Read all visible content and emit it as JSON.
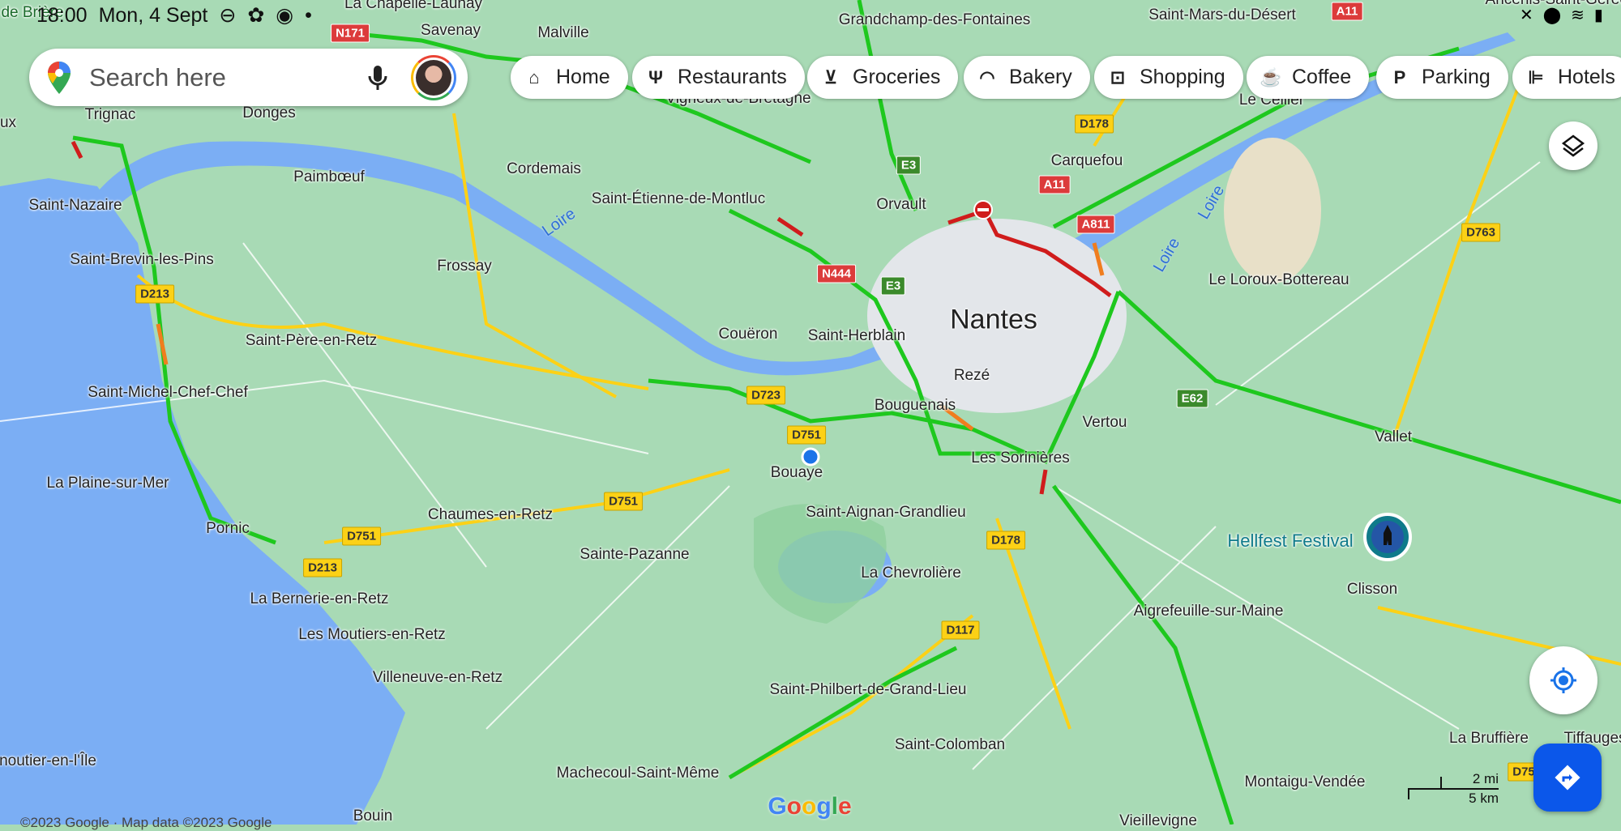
{
  "status_bar": {
    "time": "18:00",
    "date": "Mon, 4 Sept"
  },
  "search": {
    "placeholder": "Search here",
    "mic_icon": "microphone-icon",
    "avatar": "account-avatar"
  },
  "chips": [
    {
      "label": "Home",
      "icon": "home-icon"
    },
    {
      "label": "Restaurants",
      "icon": "fork-knife-icon"
    },
    {
      "label": "Groceries",
      "icon": "cart-icon"
    },
    {
      "label": "Bakery",
      "icon": "bread-icon"
    },
    {
      "label": "Shopping",
      "icon": "shopping-bag-icon"
    },
    {
      "label": "Coffee",
      "icon": "coffee-cup-icon"
    },
    {
      "label": "Parking",
      "icon": "parking-icon"
    },
    {
      "label": "Hotels",
      "icon": "bed-icon"
    }
  ],
  "map": {
    "colors": {
      "land": "#a8dab5",
      "water": "#7baef4",
      "traffic_free": "#1ec81e",
      "traffic_slow": "#f07d1e",
      "traffic_jam": "#d01c1c",
      "main_road": "#fcd116"
    },
    "city": "Nantes",
    "poi": "Hellfest Festival",
    "rivers": [
      "Loire",
      "Loire"
    ],
    "places": [
      "La Chapelle-Launay",
      "Savenay",
      "Malville",
      "Grandchamp-des-Fontaines",
      "Saint-Mars-du-Désert",
      "Ancenis-Saint-Géréon",
      "Trignac",
      "Donges",
      "Vigneux-de-Bretagne",
      "Le Cellier",
      "Saint-Nazaire",
      "Paimbœuf",
      "Cordemais",
      "Saint-Étienne-de-Montluc",
      "Orvault",
      "Carquefou",
      "Saint-Brevin-les-Pins",
      "Frossay",
      "Le Loroux-Bottereau",
      "Saint-Père-en-Retz",
      "Couëron",
      "Saint-Herblain",
      "Rezé",
      "Saint-Michel-Chef-Chef",
      "Bouguenais",
      "Vertou",
      "Vallet",
      "Les Sorinières",
      "Bouaye",
      "La Plaine-sur-Mer",
      "Saint-Aignan-Grandlieu",
      "Chaumes-en-Retz",
      "Pornic",
      "Sainte-Pazanne",
      "La Chevrolière",
      "Clisson",
      "La Bernerie-en-Retz",
      "Aigrefeuille-sur-Maine",
      "Les Moutiers-en-Retz",
      "Villeneuve-en-Retz",
      "Saint-Philbert-de-Grand-Lieu",
      "Saint-Colomban",
      "La Bruffière",
      "Tiffauges",
      "Machecoul-Saint-Même",
      "Montaigu-Vendée",
      "noutier-en-l'Île",
      "Bouin",
      "Vieillevigne",
      "de Brière",
      "ux"
    ],
    "shields": [
      "N171",
      "D213",
      "E3",
      "A11",
      "A811",
      "D178",
      "D763",
      "N444",
      "E3",
      "D723",
      "D751",
      "D751",
      "D751",
      "D213",
      "D178",
      "D117",
      "E62",
      "A11",
      "D75"
    ]
  },
  "controls": {
    "layers": "layers-icon",
    "my_location": "my-location-icon",
    "directions": "directions-icon"
  },
  "scale": {
    "miles": "2 mi",
    "km": "5 km"
  },
  "footer": {
    "logo": "Google",
    "copyright": "©2023 Google · Map data ©2023 Google"
  }
}
